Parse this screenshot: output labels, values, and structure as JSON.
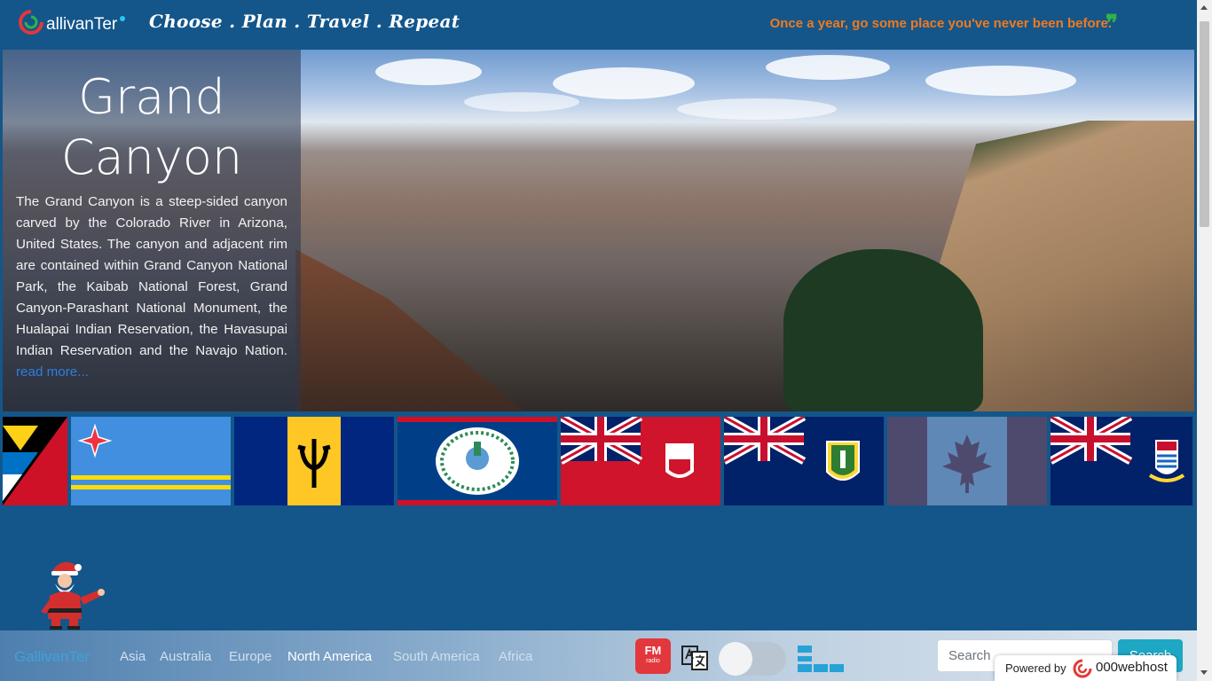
{
  "header": {
    "logo_text": "allivanTer",
    "slogan": "Choose . Plan . Travel . Repeat",
    "quote": "Once a year, go some place you've never been before.",
    "quote_mark": "❞"
  },
  "hero": {
    "title": "Grand Canyon",
    "description": "The Grand Canyon is a steep-sided canyon carved by the Colorado River in Arizona, United States. The canyon and adjacent rim are contained within Grand Canyon National Park, the Kaibab National Forest, Grand Canyon-Parashant National Monument, the Hualapai Indian Reservation, the Havasupai Indian Reservation and the Navajo Nation.",
    "read_more": "read more..."
  },
  "flags": [
    {
      "country": "Antigua and Barbuda"
    },
    {
      "country": "Aruba"
    },
    {
      "country": "Barbados"
    },
    {
      "country": "Belize"
    },
    {
      "country": "Bermuda"
    },
    {
      "country": "British Virgin Islands"
    },
    {
      "country": "Canada"
    },
    {
      "country": "Cayman Islands"
    }
  ],
  "nav": {
    "brand": "GallivanTer",
    "links": [
      "Asia",
      "Australia",
      "Europe",
      "North America",
      "South America",
      "Africa"
    ],
    "active": "North America",
    "fm_label": "FM",
    "fm_sub": "radio",
    "search_placeholder": "Search",
    "search_button": "Search"
  },
  "powered": {
    "label": "Powered by",
    "brand": "000webhost"
  },
  "colors": {
    "background": "#14568a",
    "quote": "#f07a1e",
    "quote_mark": "#2fb34a",
    "brand": "#3fa2d8",
    "search_button": "#1ea7c4"
  }
}
